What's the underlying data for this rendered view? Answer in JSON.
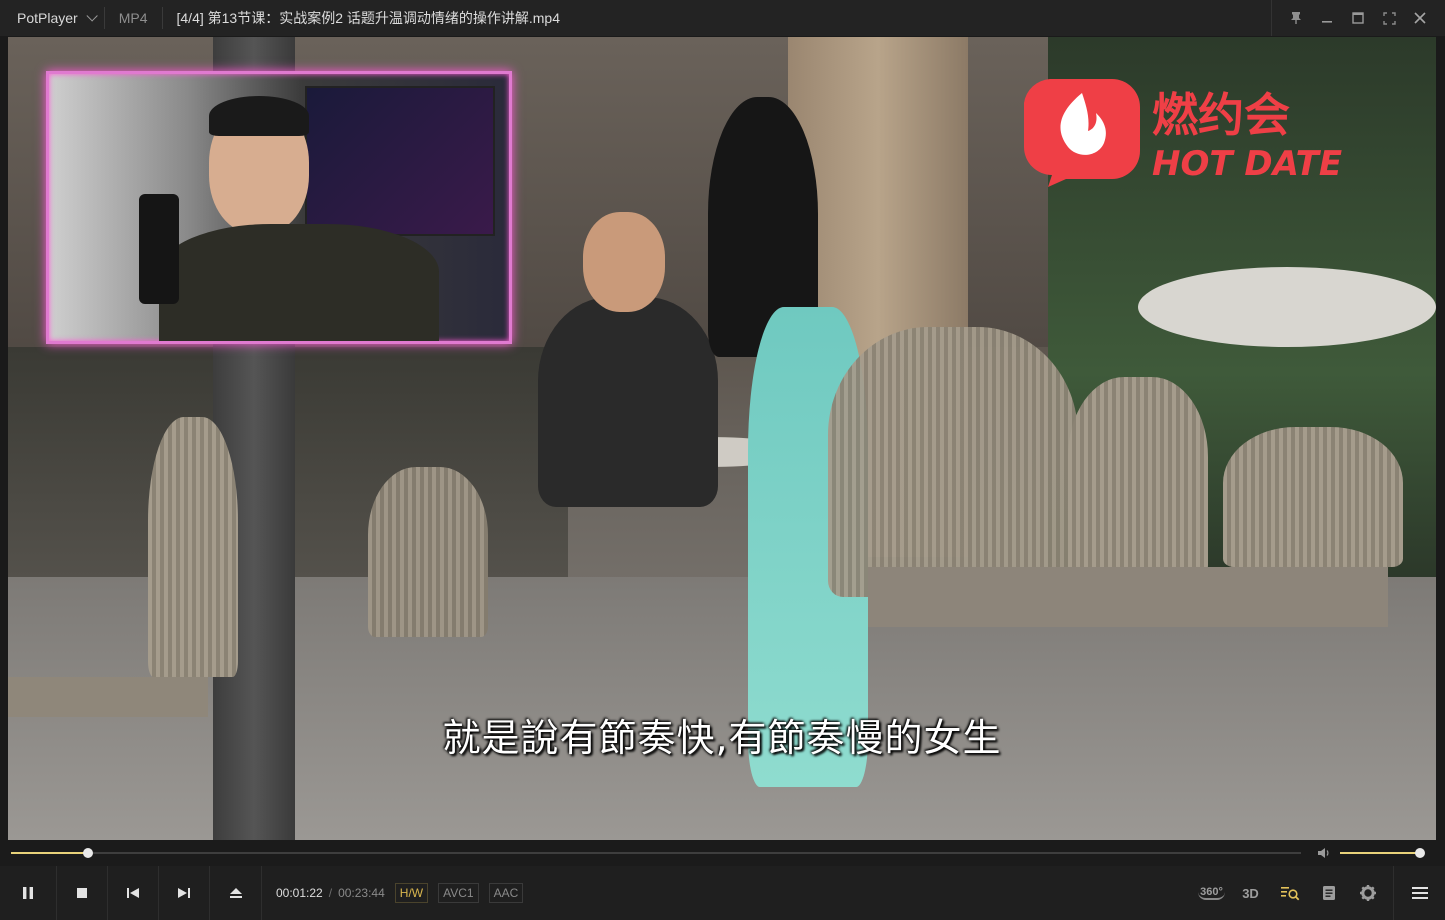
{
  "titlebar": {
    "app_name": "PotPlayer",
    "format": "MP4",
    "file_title": "[4/4] 第13节课：实战案例2 话题升温调动情绪的操作讲解.mp4",
    "controls": [
      "pin-icon",
      "minimize-icon",
      "maximize-icon",
      "fullscreen-icon",
      "close-icon"
    ]
  },
  "video": {
    "subtitle": "就是說有節奏快,有節奏慢的女生",
    "logo_cn": "燃约会",
    "logo_en": "HOT DATE"
  },
  "seek": {
    "position": 0.06,
    "volume": 1.0
  },
  "controls": {
    "time_current": "00:01:22",
    "time_separator": "/",
    "time_duration": "00:23:44",
    "hw_label": "H/W",
    "video_codec": "AVC1",
    "audio_codec": "AAC",
    "buttons": [
      "pause-icon",
      "stop-icon",
      "previous-icon",
      "next-icon",
      "eject-icon"
    ],
    "right_buttons": {
      "vr_label": "360°",
      "three_d_label": "3D"
    }
  },
  "colors": {
    "accent": "#e8d27a",
    "hw": "#d9b64e",
    "pip_border": "#e07ad0",
    "logo_red": "#ef3f46"
  }
}
